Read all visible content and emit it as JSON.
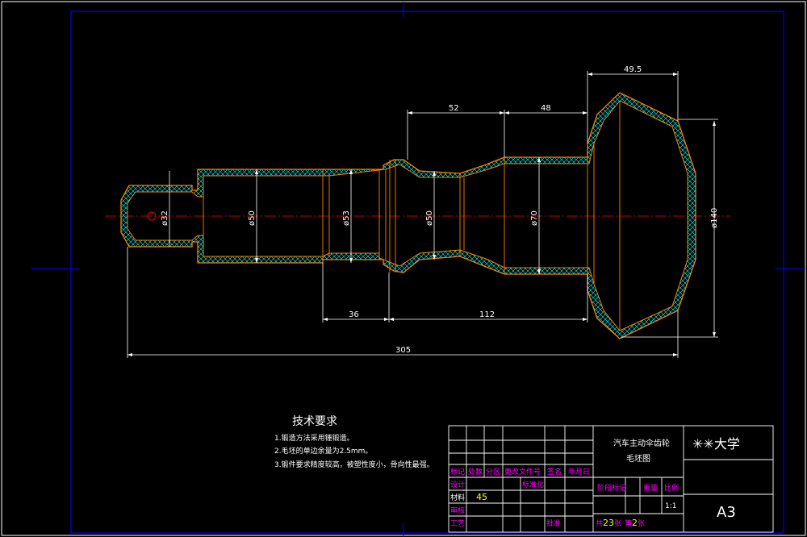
{
  "drawing": {
    "dimensions": {
      "d_49_5": "49.5",
      "d_52": "52",
      "d_48": "48",
      "d_36": "36",
      "d_112": "112",
      "d_305": "305",
      "dia_32": "ø32",
      "dia_50a": "ø50",
      "dia_53": "ø53",
      "dia_50b": "ø50",
      "dia_70": "ø70",
      "dia_140": "ø140"
    },
    "tech_requirements": {
      "title": "技术要求",
      "lines": [
        "1.锻造方法采用锤锻造。",
        "2.毛坯的单边余量为2.5mm。",
        "3.锻件要求精度较高，被塑性度小，骨向性最强。"
      ]
    },
    "title_block": {
      "part_name_line1": "汽车主动伞齿轮",
      "part_name_line2": "毛坯图",
      "school": "✳✳大学",
      "row_labels": [
        "标记",
        "处数",
        "分区",
        "更改文件号",
        "签名",
        "年月日"
      ],
      "design": "设计",
      "standardize": "标准化",
      "stage_mark": "阶段标记",
      "weight": "重量",
      "scale_label": "比例",
      "material_label": "材料",
      "material_value": "45",
      "scale_value": "1:1",
      "review": "审核",
      "process": "工艺",
      "approve": "批准",
      "sheets_total_prefix": "共",
      "sheets_total": "23",
      "sheets_total_suffix": "张",
      "sheet_no_prefix": "第",
      "sheet_no": "2",
      "sheet_no_suffix": "张",
      "paper_size": "A3"
    },
    "colors": {
      "background": "#000000",
      "frame": "#0000ff",
      "part_outline": "#ff8000",
      "dimension": "#ffffff",
      "centerline": "#ff0000",
      "hatch": "#00ffff",
      "label_text": "#ff00ff",
      "value_text": "#ffff00"
    }
  }
}
